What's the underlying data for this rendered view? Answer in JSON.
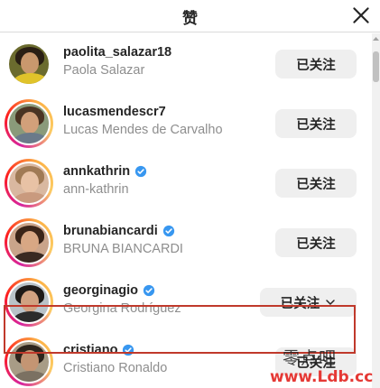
{
  "dialog": {
    "title": "赞"
  },
  "icons": {
    "close": "close-icon",
    "verified": "verified-badge-icon",
    "chevron": "chevron-down-icon"
  },
  "colors": {
    "verified": "#3897f0",
    "button_bg": "#efefef",
    "secondary_text": "#8e8e8e",
    "highlight": "#c0392b",
    "watermark": "#e53935"
  },
  "users": [
    {
      "username": "paolita_salazar18",
      "fullname": "Paola Salazar",
      "verified": false,
      "follow_label": "已关注",
      "dropdown": false
    },
    {
      "username": "lucasmendescr7",
      "fullname": "Lucas Mendes de Carvalho",
      "verified": false,
      "follow_label": "已关注",
      "dropdown": false
    },
    {
      "username": "annkathrin",
      "fullname": "ann-kathrin",
      "verified": true,
      "follow_label": "已关注",
      "dropdown": false
    },
    {
      "username": "brunabiancardi",
      "fullname": "BRUNA BIANCARDI",
      "verified": true,
      "follow_label": "已关注",
      "dropdown": false
    },
    {
      "username": "georginagio",
      "fullname": "Georgina Rodríguez",
      "verified": true,
      "follow_label": "已关注",
      "dropdown": true
    },
    {
      "username": "cristiano",
      "fullname": "Cristiano Ronaldo",
      "verified": true,
      "follow_label": "已关注",
      "dropdown": false
    }
  ],
  "watermark": {
    "top": "零点吧",
    "bottom": "www.Ldb.cc"
  }
}
